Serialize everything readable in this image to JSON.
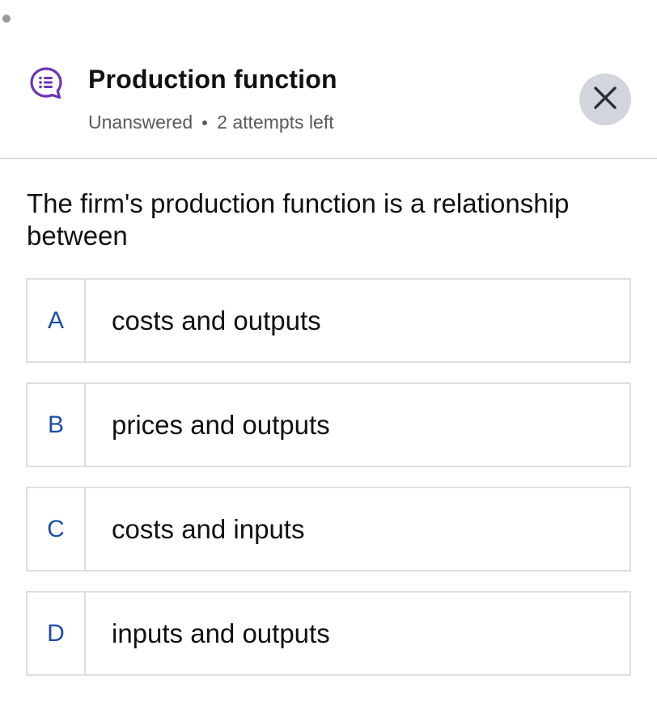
{
  "header": {
    "title": "Production function",
    "status": "Unanswered",
    "attempts": "2 attempts left",
    "icon": "quiz-chat-icon",
    "close_icon": "close-icon"
  },
  "question": {
    "text": "The firm's production function is a relationship between"
  },
  "options": [
    {
      "letter": "A",
      "text": "costs and outputs"
    },
    {
      "letter": "B",
      "text": "prices and outputs"
    },
    {
      "letter": "C",
      "text": "costs and inputs"
    },
    {
      "letter": "D",
      "text": "inputs and outputs"
    }
  ],
  "colors": {
    "accent_purple": "#6b35b5",
    "letter_blue": "#1d4fa8",
    "close_bg": "#d2d5dc",
    "border": "#dedede"
  }
}
